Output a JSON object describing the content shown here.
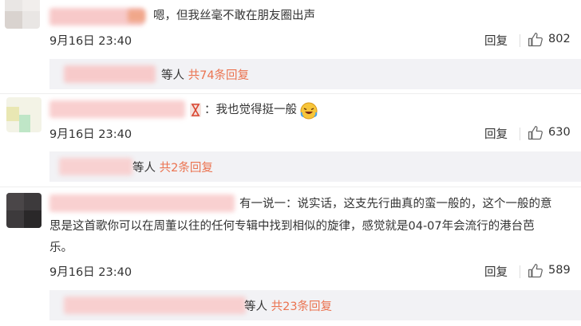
{
  "comments": [
    {
      "text": "嗯，但我丝毫不敢在朋友圈出声",
      "time": "9月16日 23:40",
      "reply_label": "回复",
      "likes": "802",
      "sub_others": "等人",
      "sub_link": "共74条回复"
    },
    {
      "text": "：我也觉得挺一般",
      "time": "9月16日 23:40",
      "reply_label": "回复",
      "likes": "630",
      "sub_others": "等人",
      "sub_link": "共2条回复"
    },
    {
      "text_line1": "有一说一：说实话，这支先行曲真的蛮一般的，这个一般的意",
      "text_line2": "思是这首歌你可以在周董以往的任何专辑中找到相似的旋律，感觉就是04-07年会流行的港台芭",
      "text_line3": "乐。",
      "time": "9月16日 23:40",
      "reply_label": "回复",
      "likes": "589",
      "sub_others": "等人",
      "sub_link": "共23条回复"
    }
  ],
  "icons": {
    "like": "thumbs-up-icon",
    "hourglass": "hourglass-icon",
    "emoji": "laughing-crying-emoji-icon"
  },
  "colors": {
    "link": "#eb7350",
    "subbox": "#f2f2f5",
    "text": "#333333"
  }
}
